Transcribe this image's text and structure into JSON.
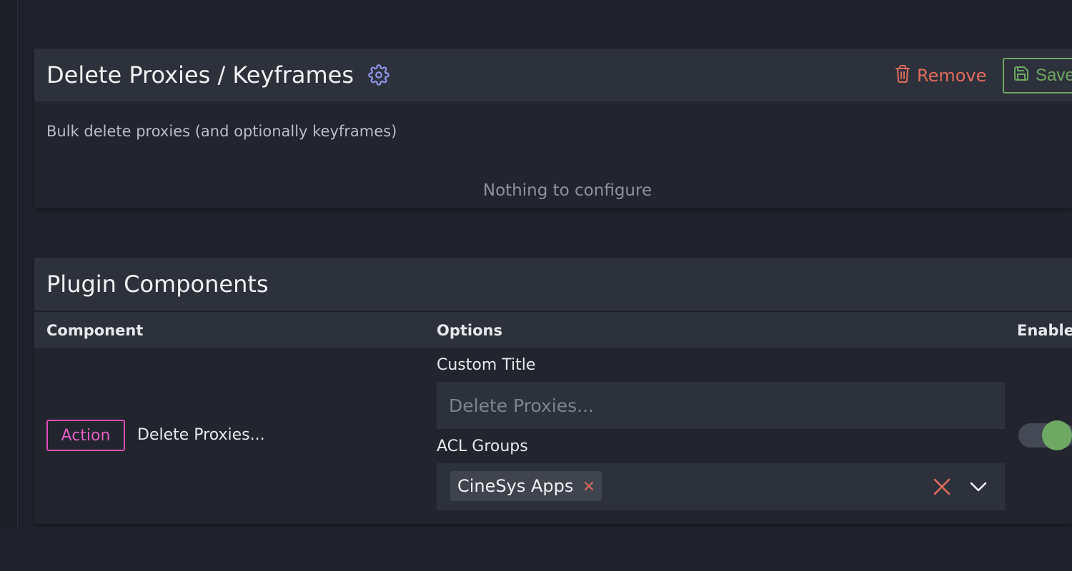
{
  "plugin": {
    "title": "Delete Proxies / Keyframes",
    "description": "Bulk delete proxies (and optionally keyframes)",
    "nothing_message": "Nothing to configure",
    "remove_label": "Remove",
    "save_label": "Save"
  },
  "components": {
    "title": "Plugin Components",
    "columns": {
      "component": "Component",
      "options": "Options",
      "enabled": "Enable"
    },
    "rows": [
      {
        "type_badge": "Action",
        "name": "Delete Proxies...",
        "custom_title_label": "Custom Title",
        "custom_title_placeholder": "Delete Proxies...",
        "custom_title_value": "",
        "acl_label": "ACL Groups",
        "acl_groups": [
          "CineSys Apps"
        ],
        "enabled": true
      }
    ]
  },
  "colors": {
    "remove": "#e06c5c",
    "save": "#6fa863",
    "action_badge": "#d94fb5",
    "toggle_on": "#6fa863"
  },
  "icons": {
    "settings": "gear-icon",
    "remove": "trash-icon",
    "save": "floppy-icon",
    "chip_remove": "close-icon",
    "clear": "close-icon",
    "dropdown": "chevron-down-icon"
  }
}
